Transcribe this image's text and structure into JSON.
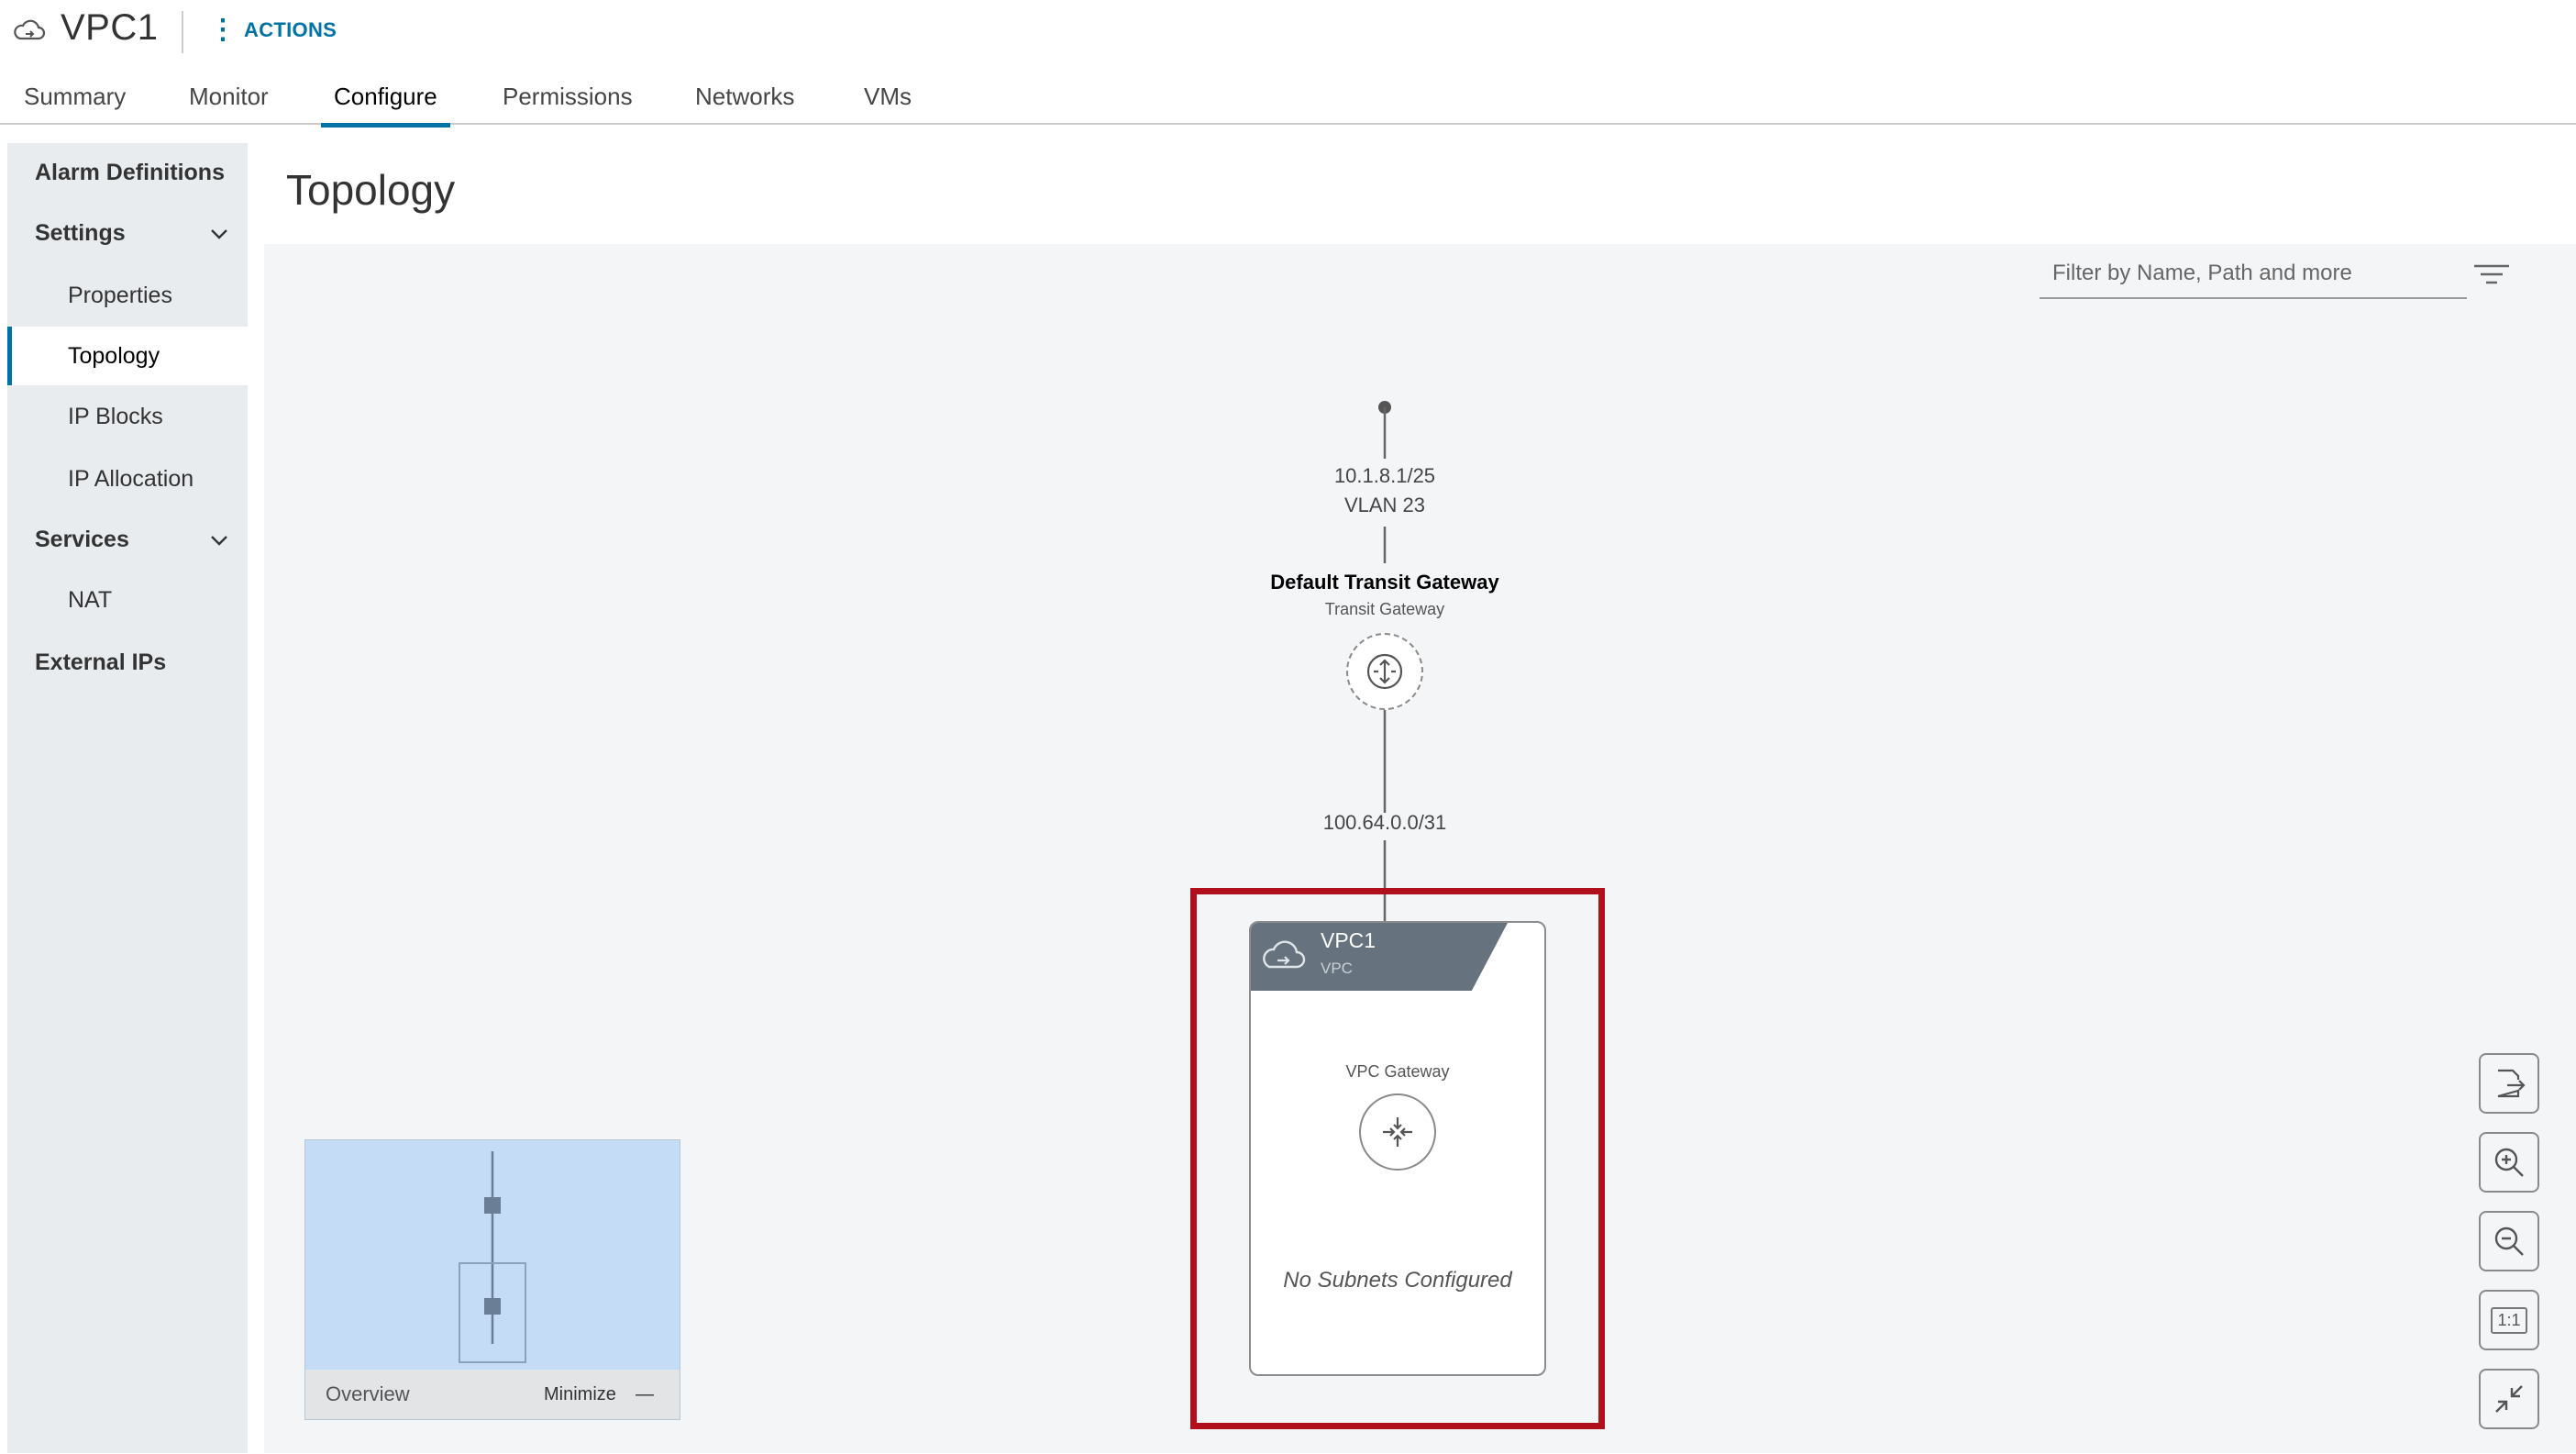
{
  "header": {
    "object_title": "VPC1",
    "actions_label": "ACTIONS",
    "object_icon": "vpc-cloud-icon"
  },
  "tabs": [
    {
      "label": "Summary",
      "active": false
    },
    {
      "label": "Monitor",
      "active": false
    },
    {
      "label": "Configure",
      "active": true
    },
    {
      "label": "Permissions",
      "active": false
    },
    {
      "label": "Networks",
      "active": false
    },
    {
      "label": "VMs",
      "active": false
    }
  ],
  "sidebar": {
    "items": [
      {
        "label": "Alarm Definitions",
        "type": "group"
      },
      {
        "label": "Settings",
        "type": "group",
        "expanded": true
      },
      {
        "label": "Properties",
        "type": "child"
      },
      {
        "label": "Topology",
        "type": "child",
        "selected": true
      },
      {
        "label": "IP Blocks",
        "type": "child"
      },
      {
        "label": "IP Allocation",
        "type": "child"
      },
      {
        "label": "Services",
        "type": "group",
        "expanded": true
      },
      {
        "label": "NAT",
        "type": "child"
      },
      {
        "label": "External IPs",
        "type": "group"
      }
    ]
  },
  "main": {
    "title": "Topology",
    "filter_placeholder": "Filter by Name, Path and more"
  },
  "topology": {
    "uplink_ip": "10.1.8.1/25",
    "uplink_vlan": "VLAN 23",
    "transit_gateway_name": "Default Transit Gateway",
    "transit_gateway_type": "Transit Gateway",
    "transit_link_ip": "100.64.0.0/31",
    "vpc_name": "VPC1",
    "vpc_type": "VPC",
    "vpc_gateway_label": "VPC Gateway",
    "no_subnets_text": "No Subnets Configured",
    "highlight_color": "#b0101b"
  },
  "overview": {
    "label": "Overview",
    "minimize_label": "Minimize",
    "minimize_glyph": "—"
  },
  "controls": {
    "one_to_one_label": "1:1",
    "icons": [
      "export-icon",
      "zoom-in-icon",
      "zoom-out-icon",
      "actual-size-icon",
      "fit-to-screen-icon"
    ]
  },
  "colors": {
    "accent": "#0072a3",
    "sidebar_bg": "#e8ecef",
    "canvas_bg": "#f4f5f7",
    "vpc_banner": "#66737e"
  }
}
